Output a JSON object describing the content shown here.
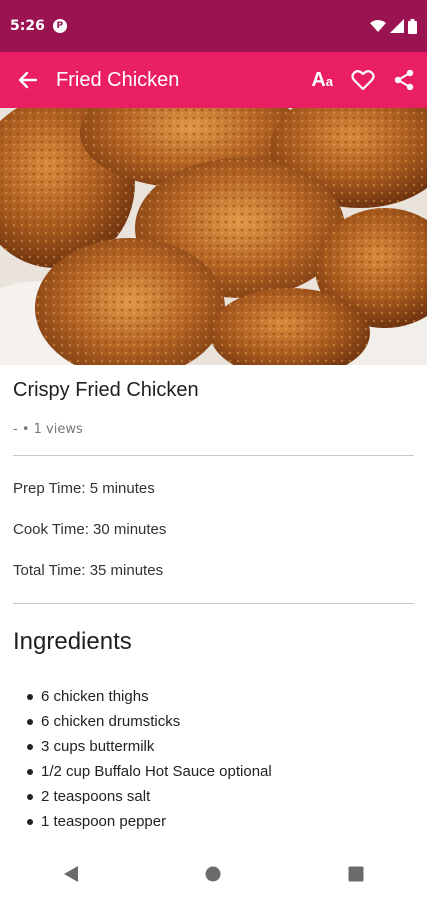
{
  "status": {
    "time": "5:26",
    "app_badge": "P"
  },
  "app_bar": {
    "title": "Fried Chicken",
    "font_size_label": "A",
    "font_size_small": "a"
  },
  "recipe": {
    "title": "Crispy Fried Chicken",
    "meta": "- • 1 views",
    "prep_time": "Prep Time: 5 minutes",
    "cook_time": "Cook Time: 30 minutes",
    "total_time": "Total Time: 35 minutes"
  },
  "ingredients": {
    "title": "Ingredients",
    "items": [
      "6 chicken thighs",
      "6 chicken drumsticks",
      "3 cups buttermilk",
      "1/2 cup Buffalo Hot Sauce optional",
      "2 teaspoons salt",
      "1 teaspoon pepper"
    ]
  },
  "colors": {
    "status_bar": "#9b1452",
    "app_bar": "#e91e63"
  }
}
